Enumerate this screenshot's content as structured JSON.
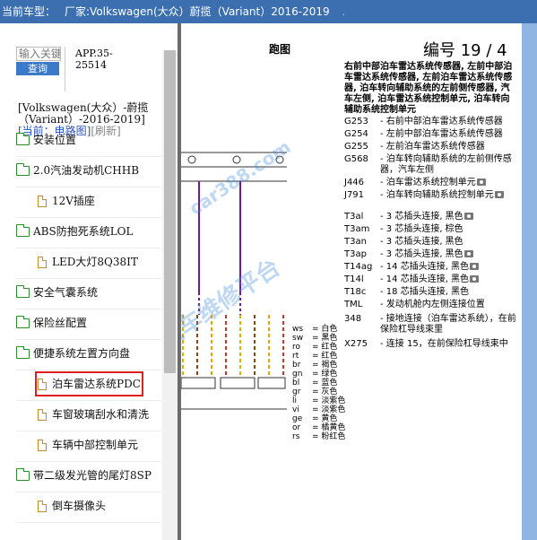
{
  "titlebar": {
    "label": "当前车型：",
    "vehicle": "厂家:Volkswagen(大众）蔚揽（Variant）2016-2019",
    "dot": "."
  },
  "search": {
    "placeholder": "输入关键",
    "button": "查询",
    "app_code_line1": "APP.35-",
    "app_code_line2": "25514"
  },
  "vehicle_info": {
    "line1": "[Volkswagen(大众）-蔚揽",
    "line2": "（Variant）-2016-2019]",
    "current": "[当前：电路图]",
    "refresh": "[刷新]"
  },
  "tree": [
    {
      "label": "安装位置",
      "type": "folder"
    },
    {
      "label": "2.0汽油发动机CHHB",
      "type": "folder"
    },
    {
      "label": "12V插座",
      "type": "file"
    },
    {
      "label": "ABS防抱死系统LOL",
      "type": "folder"
    },
    {
      "label": "LED大灯8Q38IT",
      "type": "file"
    },
    {
      "label": "安全气囊系统",
      "type": "folder"
    },
    {
      "label": "保险丝配置",
      "type": "folder"
    },
    {
      "label": "便捷系统左置方向盘",
      "type": "folder"
    },
    {
      "label": "泊车雷达系统PDC",
      "type": "file",
      "selected": true
    },
    {
      "label": "车窗玻璃刮水和清洗",
      "type": "file"
    },
    {
      "label": "车辆中部控制单元",
      "type": "file"
    },
    {
      "label": "带二级发光管的尾灯8SP",
      "type": "folder"
    },
    {
      "label": "倒车摄像头",
      "type": "file"
    }
  ],
  "doc": {
    "sheet_title": "跑图",
    "page_no": "编号  19 / 4",
    "heading": "右前中部泊车雷达系统传感器, 左前中部泊车雷达系统传感器, 左前泊车雷达系统传感器, 泊车转向辅助系统的左前侧传感器, 汽车左侧, 泊车雷达系统控制单元, 泊车转向辅助系统控制单元",
    "legend": [
      {
        "code": "G253",
        "desc": "- 右前中部泊车雷达系统传感器"
      },
      {
        "code": "G254",
        "desc": "- 左前中部泊车雷达系统传感器"
      },
      {
        "code": "G255",
        "desc": "- 左前泊车雷达系统传感器"
      },
      {
        "code": "G568",
        "desc": "- 泊车转向辅助系统的左前侧传感器，汽车左侧"
      },
      {
        "code": "J446",
        "desc": "- 泊车雷达系统控制单元",
        "cam": true
      },
      {
        "code": "J791",
        "desc": "- 泊车转向辅助系统控制单元",
        "cam": true
      },
      {
        "code": "T3al",
        "desc": "- 3 芯插头连接, 黑色",
        "cam": true
      },
      {
        "code": "T3am",
        "desc": "- 3 芯插头连接, 棕色"
      },
      {
        "code": "T3an",
        "desc": "- 3 芯插头连接, 黑色"
      },
      {
        "code": "T3ap",
        "desc": "- 3 芯插头连接, 黑色",
        "cam": true
      },
      {
        "code": "T14ag",
        "desc": "- 14 芯插头连接, 黑色",
        "cam": true
      },
      {
        "code": "T14l",
        "desc": "- 14 芯插头连接, 黑色",
        "cam": true
      },
      {
        "code": "T18c",
        "desc": "- 18 芯插头连接, 黑色"
      },
      {
        "code": "TML",
        "desc": "- 发动机舱内左侧连接位置"
      },
      {
        "code": "348",
        "desc": "- 接地连接（泊车雷达系统），在前保险杠导线束里"
      },
      {
        "code": "X275",
        "desc": "- 连接 15，在前保险杠导线束中"
      }
    ],
    "wire_colors": [
      {
        "k": "ws",
        "v": "= 白色"
      },
      {
        "k": "sw",
        "v": "= 黑色"
      },
      {
        "k": "ro",
        "v": "= 红色"
      },
      {
        "k": "rt",
        "v": "= 红色"
      },
      {
        "k": "br",
        "v": "= 褐色"
      },
      {
        "k": "gn",
        "v": "= 绿色"
      },
      {
        "k": "bl",
        "v": "= 蓝色"
      },
      {
        "k": "gr",
        "v": "= 灰色"
      },
      {
        "k": "li",
        "v": "= 淡紫色"
      },
      {
        "k": "vi",
        "v": "= 淡紫色"
      },
      {
        "k": "ge",
        "v": "= 黄色"
      },
      {
        "k": "or",
        "v": "= 橘黄色"
      },
      {
        "k": "rs",
        "v": "= 粉红色"
      }
    ],
    "watermark_site": "car388.com",
    "watermark_brand": "易汽车维修平台"
  },
  "colors": {
    "titlebar_bg": "#3b6fb0",
    "query_btn": "#3d79c9",
    "selected_outline": "#e02020",
    "folder_green": "#2c8c2c",
    "file_orange": "#c98a2a",
    "right_strip": "#8fb5e3"
  }
}
